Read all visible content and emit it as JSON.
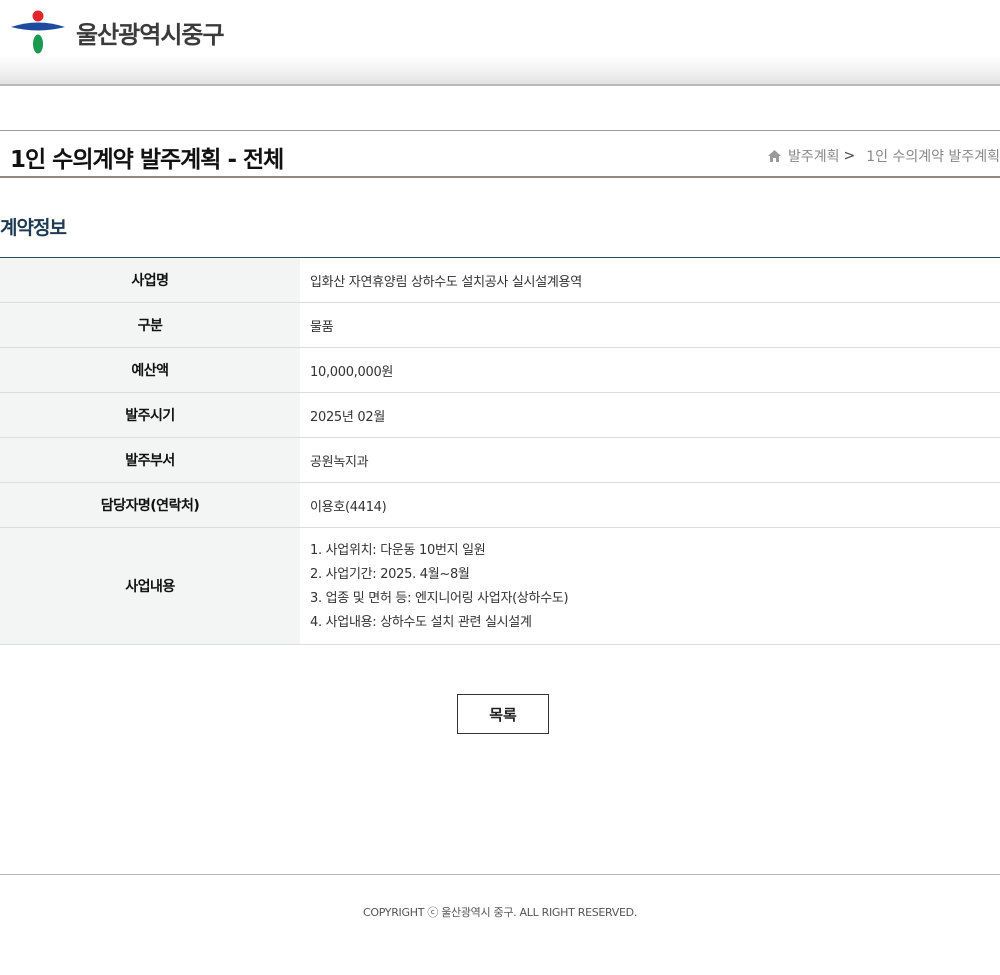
{
  "header": {
    "logo_text": "울산광역시중구"
  },
  "page": {
    "title": "1인 수의계약 발주계획 - 전체",
    "breadcrumb": [
      "발주계획",
      "1인 수의계약 발주계획"
    ]
  },
  "section": {
    "title": "계약정보"
  },
  "contract": {
    "rows": [
      {
        "label": "사업명",
        "value": "입화산 자연휴양림 상하수도 설치공사 실시설계용역"
      },
      {
        "label": "구분",
        "value": "물품"
      },
      {
        "label": "예산액",
        "value": "10,000,000원"
      },
      {
        "label": "발주시기",
        "value": "2025년 02월"
      },
      {
        "label": "발주부서",
        "value": "공원녹지과"
      },
      {
        "label": "담당자명(연락처)",
        "value": "이용호(4414)"
      }
    ],
    "content": {
      "label": "사업내용",
      "lines": [
        "1. 사업위치: 다운동 10번지 일원",
        "2. 사업기간: 2025. 4월~8월",
        "3. 업종 및 면허 등: 엔지니어링 사업자(상하수도)",
        "4. 사업내용: 상하수도 설치 관련 실시설계"
      ]
    }
  },
  "buttons": {
    "list_label": "목록"
  },
  "footer": {
    "copyright": "COPYRIGHT ⓒ 울산광역시 중구. ALL RIGHT RESERVED."
  },
  "colors": {
    "section_title": "#1d3a52",
    "logo_red": "#e4262c",
    "logo_blue": "#1e4aa0",
    "logo_green": "#1a9a4e"
  }
}
